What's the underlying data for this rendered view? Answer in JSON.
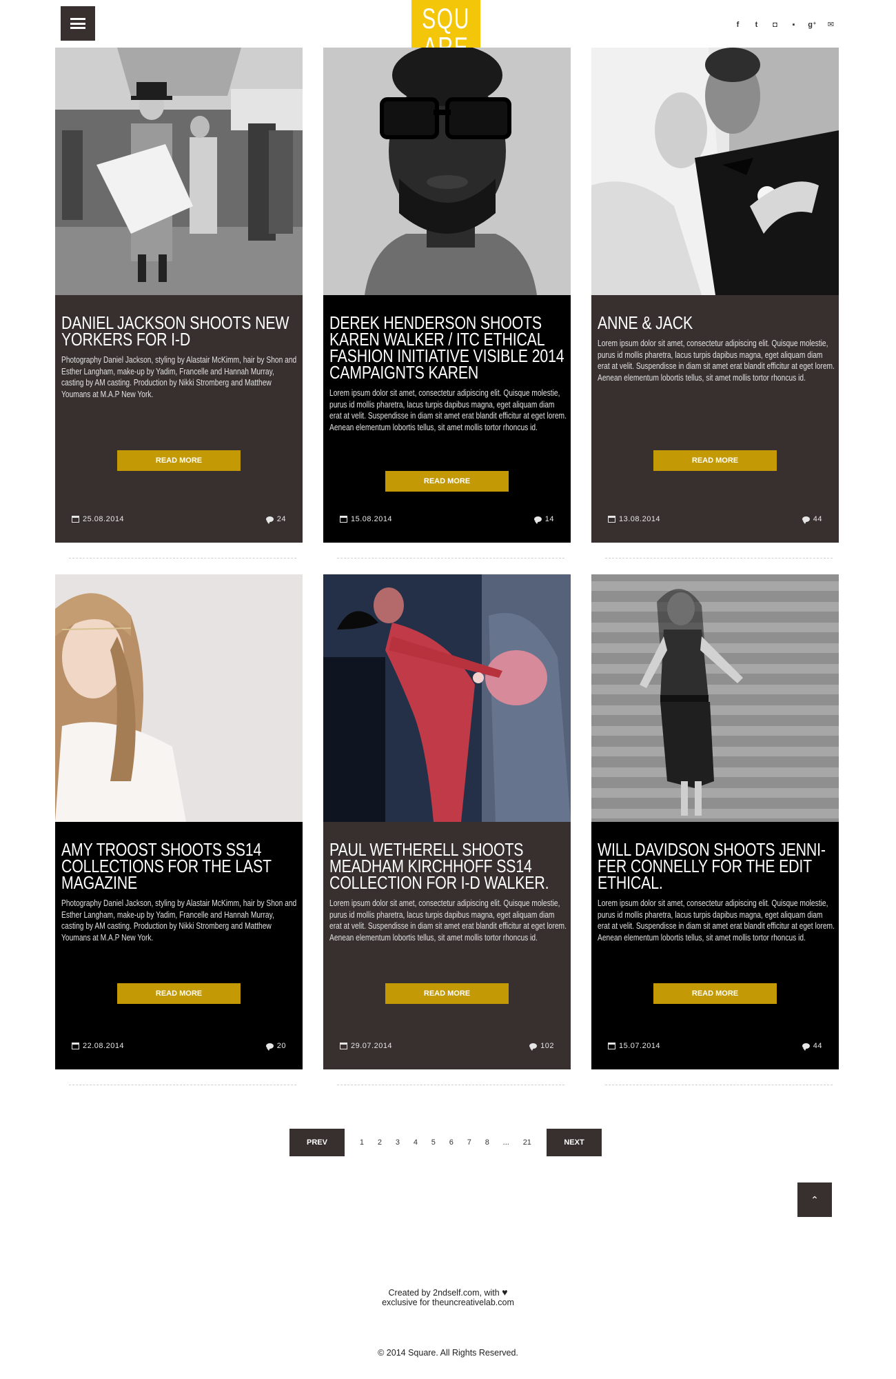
{
  "header": {
    "logo_line1": "SQU",
    "logo_line2": "ARE",
    "social_icons": [
      "facebook-icon",
      "twitter-icon",
      "instagram-icon",
      "flickr-icon",
      "google-plus-icon",
      "mail-icon"
    ],
    "social_glyphs": [
      "f",
      "t",
      "◘",
      "▪",
      "g⁺",
      "✉"
    ]
  },
  "posts": [
    {
      "title": "DANIEL JACKSON SHOOTS NEW YORKERS FOR I-D",
      "excerpt": "Photography Daniel Jackson,  styling by Alastair McKimm, hair by Shon  and Esther Langham, make-up by Yadim,  Francelle and Hannah Murray,\ncasting by AM casting. Production  by Nikki Stromberg and Matthew Youmans at M.A.P New York.",
      "read_more": "READ MORE",
      "date": "25.08.2014",
      "comments": "24",
      "image": "newspaper-reader-photo"
    },
    {
      "title": "DEREK HENDERSON SHOOTS KAREN WALKER / ITC ETHICAL FASHION INITIATIVE VISIBLE 2014 CAMPAIGNTS KAREN",
      "excerpt": "Lorem ipsum dolor sit amet, consectetur adipiscing elit. Quisque molestie, purus id mollis pharetra, lacus turpis dapibus magna, eget aliquam diam erat at velit. Suspendisse in diam sit amet erat blandit efficitur at eget lorem. Aenean elementum lobortis tellus, sit amet mollis tortor rhoncus id.",
      "read_more": "READ MORE",
      "date": "15.08.2014",
      "comments": "14",
      "image": "man-with-glasses-photo"
    },
    {
      "title": "ANNE & JACK",
      "excerpt": "Lorem ipsum dolor sit amet, consectetur adipiscing elit. Quisque molestie, purus id mollis pharetra, lacus turpis dapibus magna, eget aliquam diam erat at velit. Suspendisse in diam sit amet erat blandit efficitur at eget lorem. Aenean elementum lobortis tellus, sit amet mollis tortor rhoncus id.",
      "read_more": "READ MORE",
      "date": "13.08.2014",
      "comments": "44",
      "image": "wedding-couple-photo"
    },
    {
      "title": "AMY TROOST SHOOTS SS14 COLLECTIONS FOR THE LAST MAGAZINE",
      "excerpt": "Photography Daniel Jackson,  styling by Alastair McKimm, hair by Shon  and Esther Langham, make-up by Yadim,  Francelle and Hannah Murray,\ncasting by AM casting. Production  by Nikki Stromberg and Matthew Youmans at M.A.P New York.",
      "read_more": "READ MORE",
      "date": "22.08.2014",
      "comments": "20",
      "image": "blonde-woman-photo"
    },
    {
      "title": "PAUL WETHERELL SHOOTS MEADHAM KIRCHHOFF SS14 COLLECTION FOR I-D WALKER.",
      "excerpt": "Lorem ipsum dolor sit amet, consectetur adipiscing elit. Quisque molestie, purus id mollis pharetra, lacus turpis dapibus magna, eget aliquam diam erat at velit. Suspendisse in diam sit amet erat blandit efficitur at eget lorem. Aenean elementum lobortis tellus, sit amet mollis tortor rhoncus id.",
      "read_more": "READ MORE",
      "date": "29.07.2014",
      "comments": "102",
      "image": "red-dress-photo"
    },
    {
      "title": "WILL DAVIDSON SHOOTS JENNI-FER CONNELLY FOR THE EDIT ETHICAL.",
      "excerpt": "Lorem ipsum dolor sit amet, consectetur adipiscing elit. Quisque molestie, purus id mollis pharetra, lacus turpis dapibus magna, eget aliquam diam erat at velit. Suspendisse in diam sit amet erat blandit efficitur at eget lorem. Aenean elementum lobortis tellus, sit amet mollis tortor rhoncus id.",
      "read_more": "READ MORE",
      "date": "15.07.2014",
      "comments": "44",
      "image": "woman-by-wooden-wall-photo"
    }
  ],
  "pagination": {
    "prev": "PREV",
    "next": "NEXT",
    "pages": [
      "1",
      "2",
      "3",
      "4",
      "5",
      "6",
      "7",
      "8",
      "...",
      "21"
    ]
  },
  "back_to_top": "⌃",
  "footer": {
    "line1": "Created by 2ndself.com, with",
    "line2": "exclusive for theuncreativelab.com",
    "copyright": "© 2014 Square. All Rights Reserved."
  },
  "colors": {
    "accent_yellow": "#f3c60a",
    "button_gold": "#c39a05",
    "dark_card": "#38302f",
    "black_card": "#000000"
  }
}
